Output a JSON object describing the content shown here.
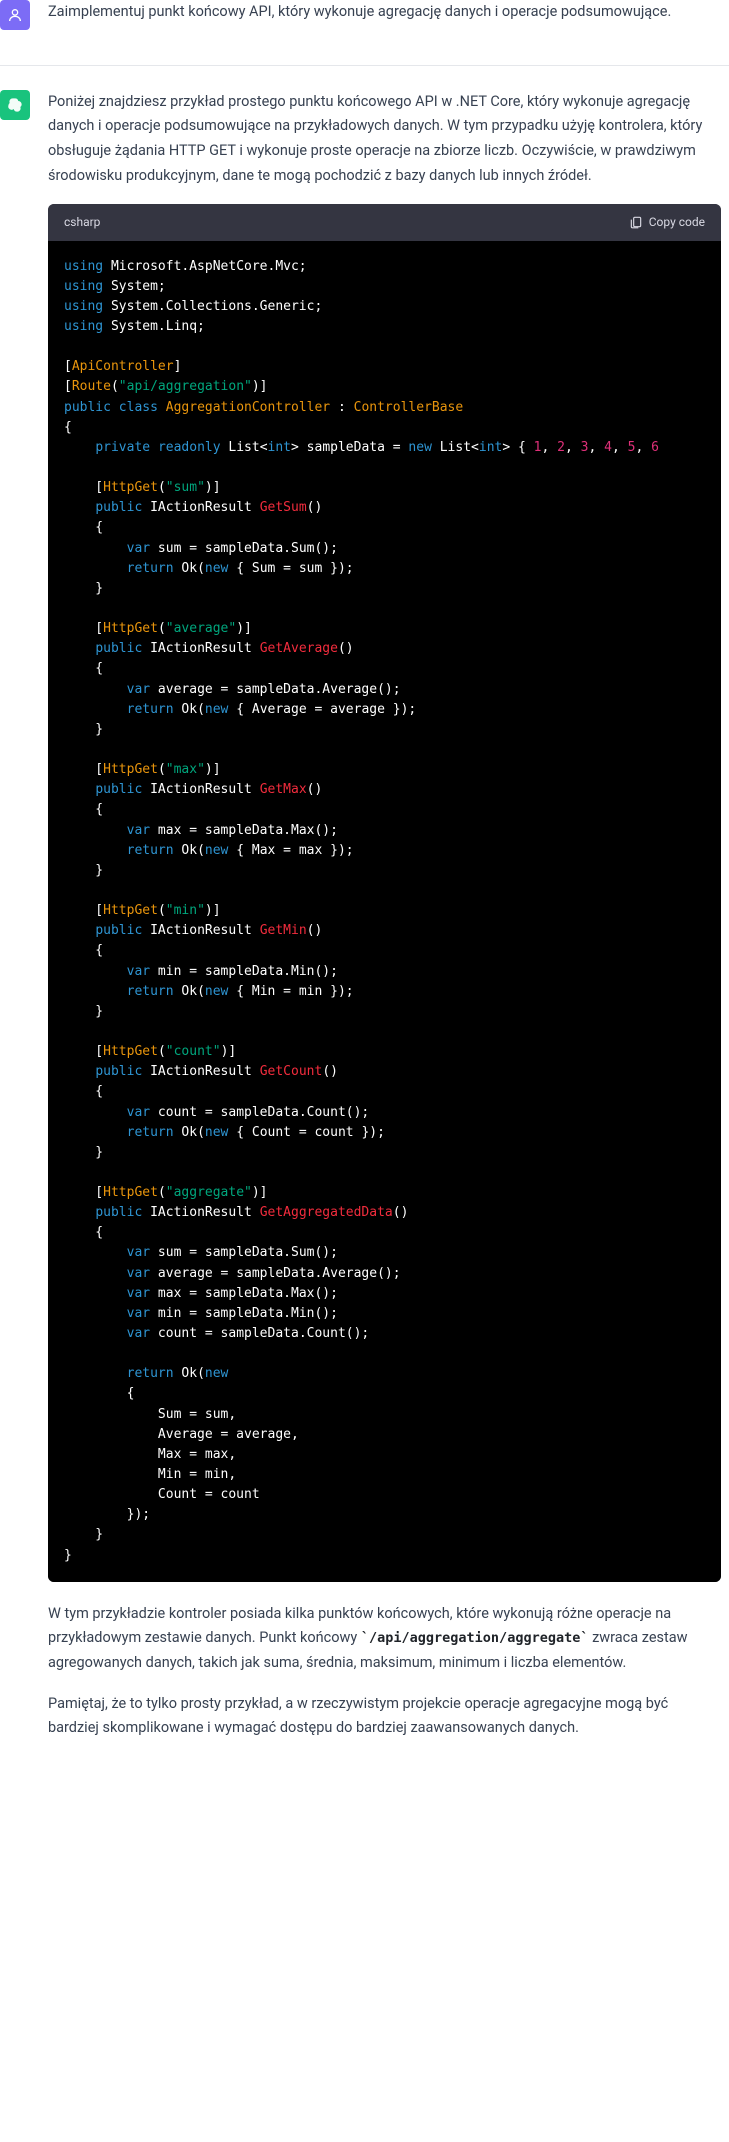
{
  "user_message": "Zaimplementuj punkt końcowy API, który wykonuje agregację danych i operacje podsumowujące.",
  "assistant_intro": "Poniżej znajdziesz przykład prostego punktu końcowego API w .NET Core, który wykonuje agregację danych i operacje podsumowujące na przykładowych danych. W tym przypadku użyję kontrolera, który obsługuje żądania HTTP GET i wykonuje proste operacje na zbiorze liczb. Oczywiście, w prawdziwym środowisku produkcyjnym, dane te mogą pochodzić z bazy danych lub innych źródeł.",
  "code_lang": "csharp",
  "copy_label": "Copy code",
  "outro_1_a": "W tym przykładzie kontroler posiada kilka punktów końcowych, które wykonują różne operacje na przykładowym zestawie danych. Punkt końcowy ",
  "outro_1_code": "`/api/aggregation/aggregate`",
  "outro_1_b": " zwraca zestaw agregowanych danych, takich jak suma, średnia, maksimum, minimum i liczba elementów.",
  "outro_2": "Pamiętaj, że to tylko prosty przykład, a w rzeczywistym projekcie operacje agregacyjne mogą być bardziej skomplikowane i wymagać dostępu do bardziej zaawansowanych danych.",
  "code": {
    "using1": "Microsoft.AspNetCore.Mvc;",
    "using2": "System;",
    "using3": "System.Collections.Generic;",
    "using4": "System.Linq;",
    "attr_api": "ApiController",
    "route_str": "\"api/aggregation\"",
    "class_name": "AggregationController",
    "base_name": "ControllerBase",
    "field_decl": "List<int> sampleData = ",
    "list_type": "List<int>",
    "nums": [
      "1",
      "2",
      "3",
      "4",
      "5",
      "6"
    ],
    "sum_route": "\"sum\"",
    "avg_route": "\"average\"",
    "max_route": "\"max\"",
    "min_route": "\"min\"",
    "count_route": "\"count\"",
    "agg_route": "\"aggregate\"",
    "fn_sum": "GetSum",
    "fn_avg": "GetAverage",
    "fn_max": "GetMax",
    "fn_min": "GetMin",
    "fn_count": "GetCount",
    "fn_agg": "GetAggregatedData"
  }
}
